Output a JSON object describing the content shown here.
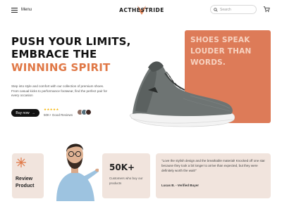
{
  "header": {
    "menu_label": "Menu",
    "logo_text": "ACTHESTRIDE",
    "search_placeholder": "Search"
  },
  "hero": {
    "headline_line1": "PUSH YOUR LIMITS,",
    "headline_line2": "EMBRACE THE",
    "headline_line3": "WINNING SPIRIT",
    "description": "Step into style and comfort with our collection of premium shoes. From casual kicks to performance footwear, find the perfect pair for every occasion",
    "buy_label": "Buy now",
    "buy_arrow": "→",
    "stars": "★★★★★",
    "reviews_text": "50K+ Good Reviews"
  },
  "promo": {
    "text": "SHOES SPEAK LOUDER THAN WORDS."
  },
  "review_card": {
    "label_line1": "Review",
    "label_line2": "Product"
  },
  "stats": {
    "number": "50K+",
    "caption": "Customers who buy our products"
  },
  "testimonial": {
    "quote": "\"Love the stylish design and the breathable material! Knocked off one star because they took a bit longer to arrive than expected, but they were definitely worth the wait!\"",
    "author": "Lucas B. - Verified Buyer"
  },
  "colors": {
    "accent": "#e07846",
    "promo_bg": "#dd7b58",
    "card_bg": "#f1e4dd",
    "shoe_gray": "#6e7473"
  }
}
